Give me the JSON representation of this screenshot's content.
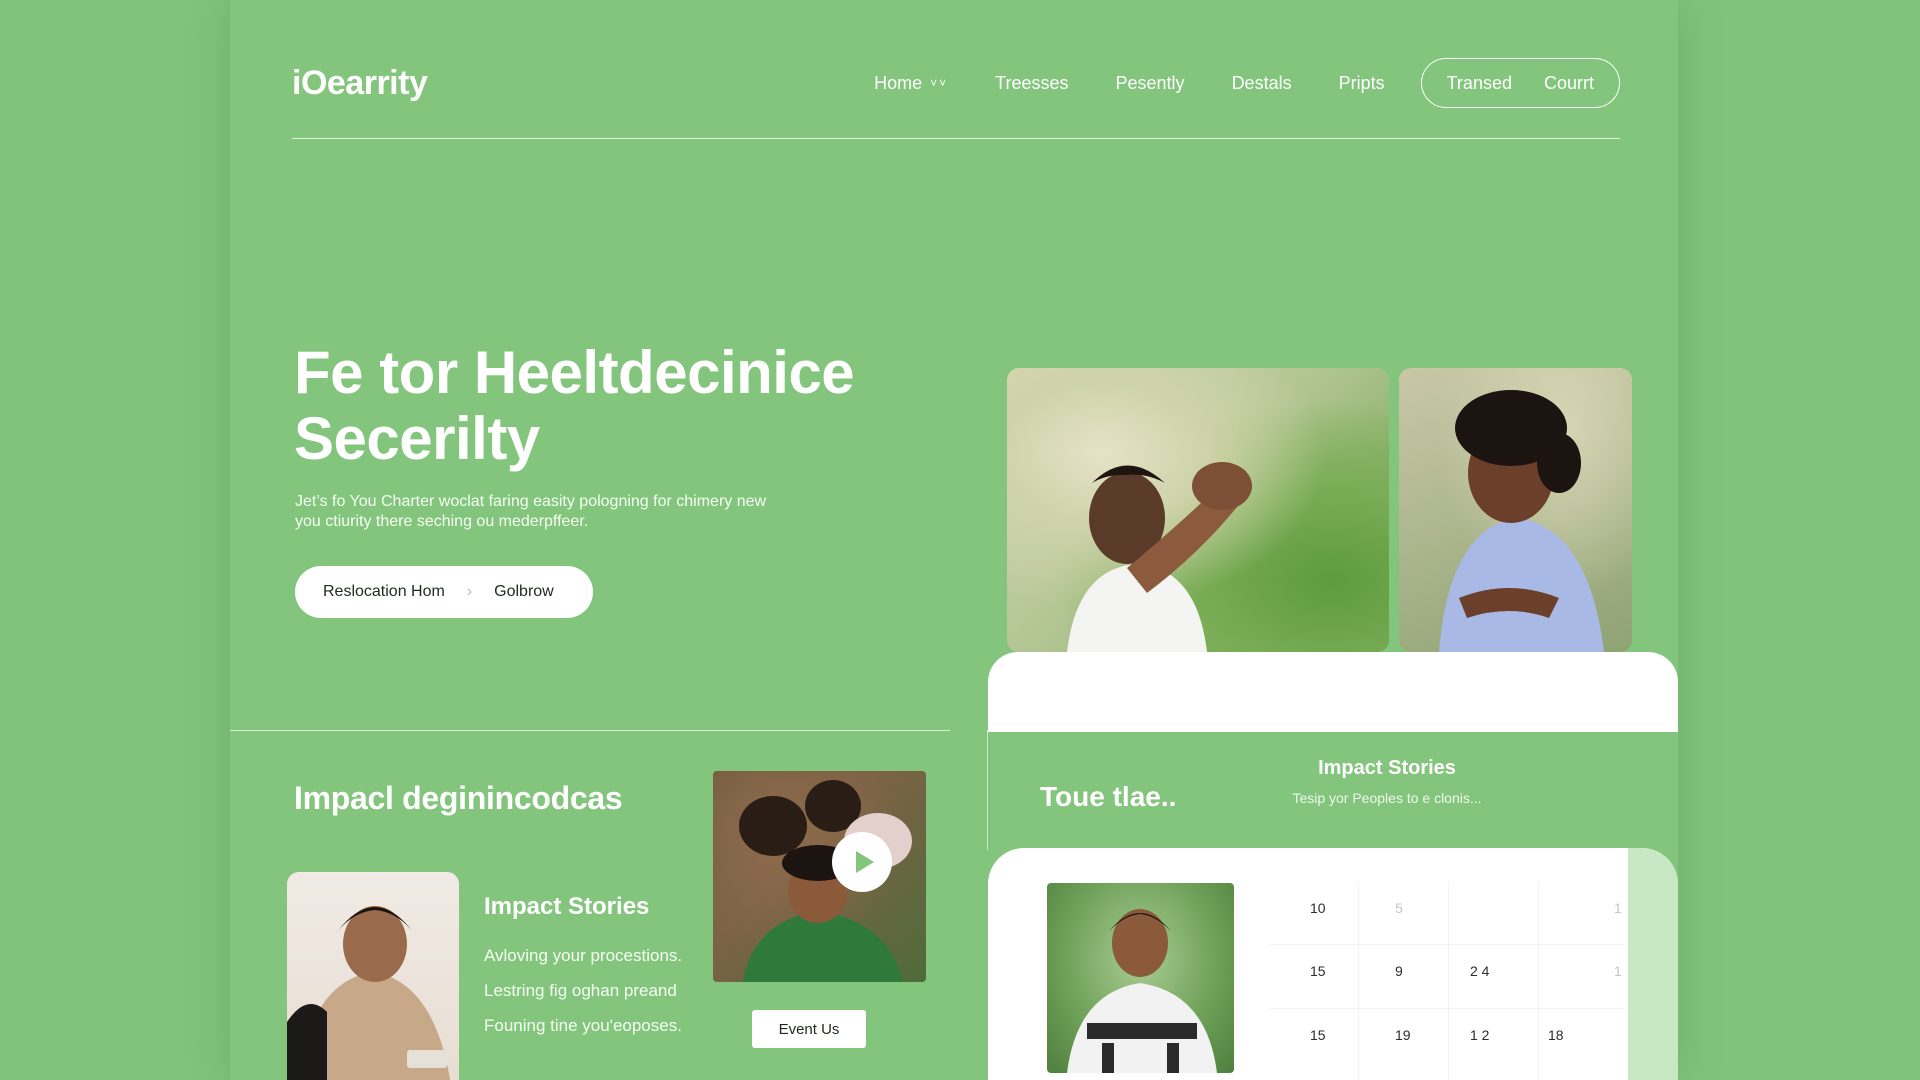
{
  "nav": {
    "logo": "iOearrity",
    "links": [
      {
        "label": "Home",
        "chevron": "˅˅"
      },
      {
        "label": "Treesses"
      },
      {
        "label": "Pesently"
      },
      {
        "label": "Destals"
      },
      {
        "label": "Pripts"
      }
    ],
    "pill": [
      "Transed",
      "Courrt"
    ]
  },
  "hero": {
    "title_line1": "Fe tor Heeltdecinice",
    "title_line2": "Secerilty",
    "subtitle_line1": "Jet’s fo You Charter woclat faring easity pologning for chimery new",
    "subtitle_line2": "you ctiurity there seching ou mederpffeer.",
    "pill_left": "Reslocation Hom",
    "pill_sep": "›",
    "pill_right": "Golbrow"
  },
  "impact_left": {
    "title": "Impacl deginincodcas",
    "stories_title": "Impact Stories",
    "items": [
      "Avloving your procestions.",
      "Lestring fig oghan preand",
      "Founing tine you'eoposes."
    ],
    "event_button": "Event Us"
  },
  "impact_right": {
    "left_title": "Toue tlae..",
    "title": "Impact Stories",
    "subtitle": "Tesip yor Peoples to e clonis..."
  },
  "calendar": {
    "rows": [
      [
        "10",
        "5",
        "",
        "",
        "1"
      ],
      [
        "15",
        "9",
        "2 4",
        "",
        "1"
      ],
      [
        "15",
        "19",
        "1 2",
        "18",
        ""
      ]
    ]
  },
  "colors": {
    "background": "#80c47c",
    "panel": "#84c57e",
    "accent_light": "#c8e7c3",
    "text_dark": "#1f2a1f"
  },
  "icons": [
    "chevron-down-icon",
    "chevron-right-icon",
    "play-icon"
  ]
}
